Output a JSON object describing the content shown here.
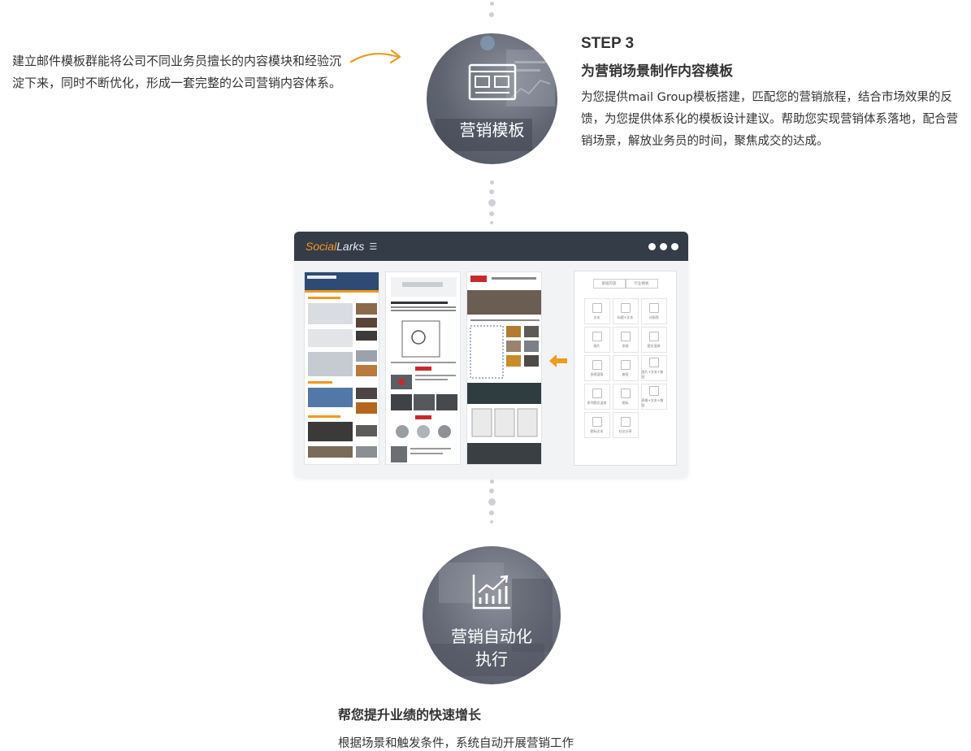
{
  "left_note": {
    "text": "建立邮件模板群能将公司不同业务员擅长的内容模块和经验沉淀下来，同时不断优化，形成一套完整的公司营销内容体系。"
  },
  "step3": {
    "label": "STEP 3",
    "title": "为营销场景制作内容模板",
    "description": "为您提供mail Group模板搭建，匹配您的营销旅程，结合市场效果的反馈，为您提供体系化的模板设计建议。帮助您实现营销体系落地，配合营销场景，解放业务员的时间，聚焦成交的达成。",
    "circle_label": "营销模板"
  },
  "app_window": {
    "brand_part1": "Social",
    "brand_part2": "Larks",
    "palette_tabs": [
      "基础内容",
      "行业模板"
    ],
    "palette_items": [
      "文本",
      "标题+文本",
      "分割线",
      "图片",
      "多图",
      "图文混排",
      "多图混排",
      "按钮",
      "图片+文本+按钮",
      "多列图文混排",
      "图标",
      "表格+文本+按钮",
      "图标文本",
      "社交分享"
    ]
  },
  "step4": {
    "circle_label_line1": "营销自动化",
    "circle_label_line2": "执行",
    "title": "帮您提升业绩的快速增长",
    "description": "根据场景和触发条件，系统自动开展营销工作"
  },
  "colors": {
    "accent_orange": "#f29a1d",
    "titlebar": "#343c48",
    "dot_gray": "#cdd0d6"
  }
}
